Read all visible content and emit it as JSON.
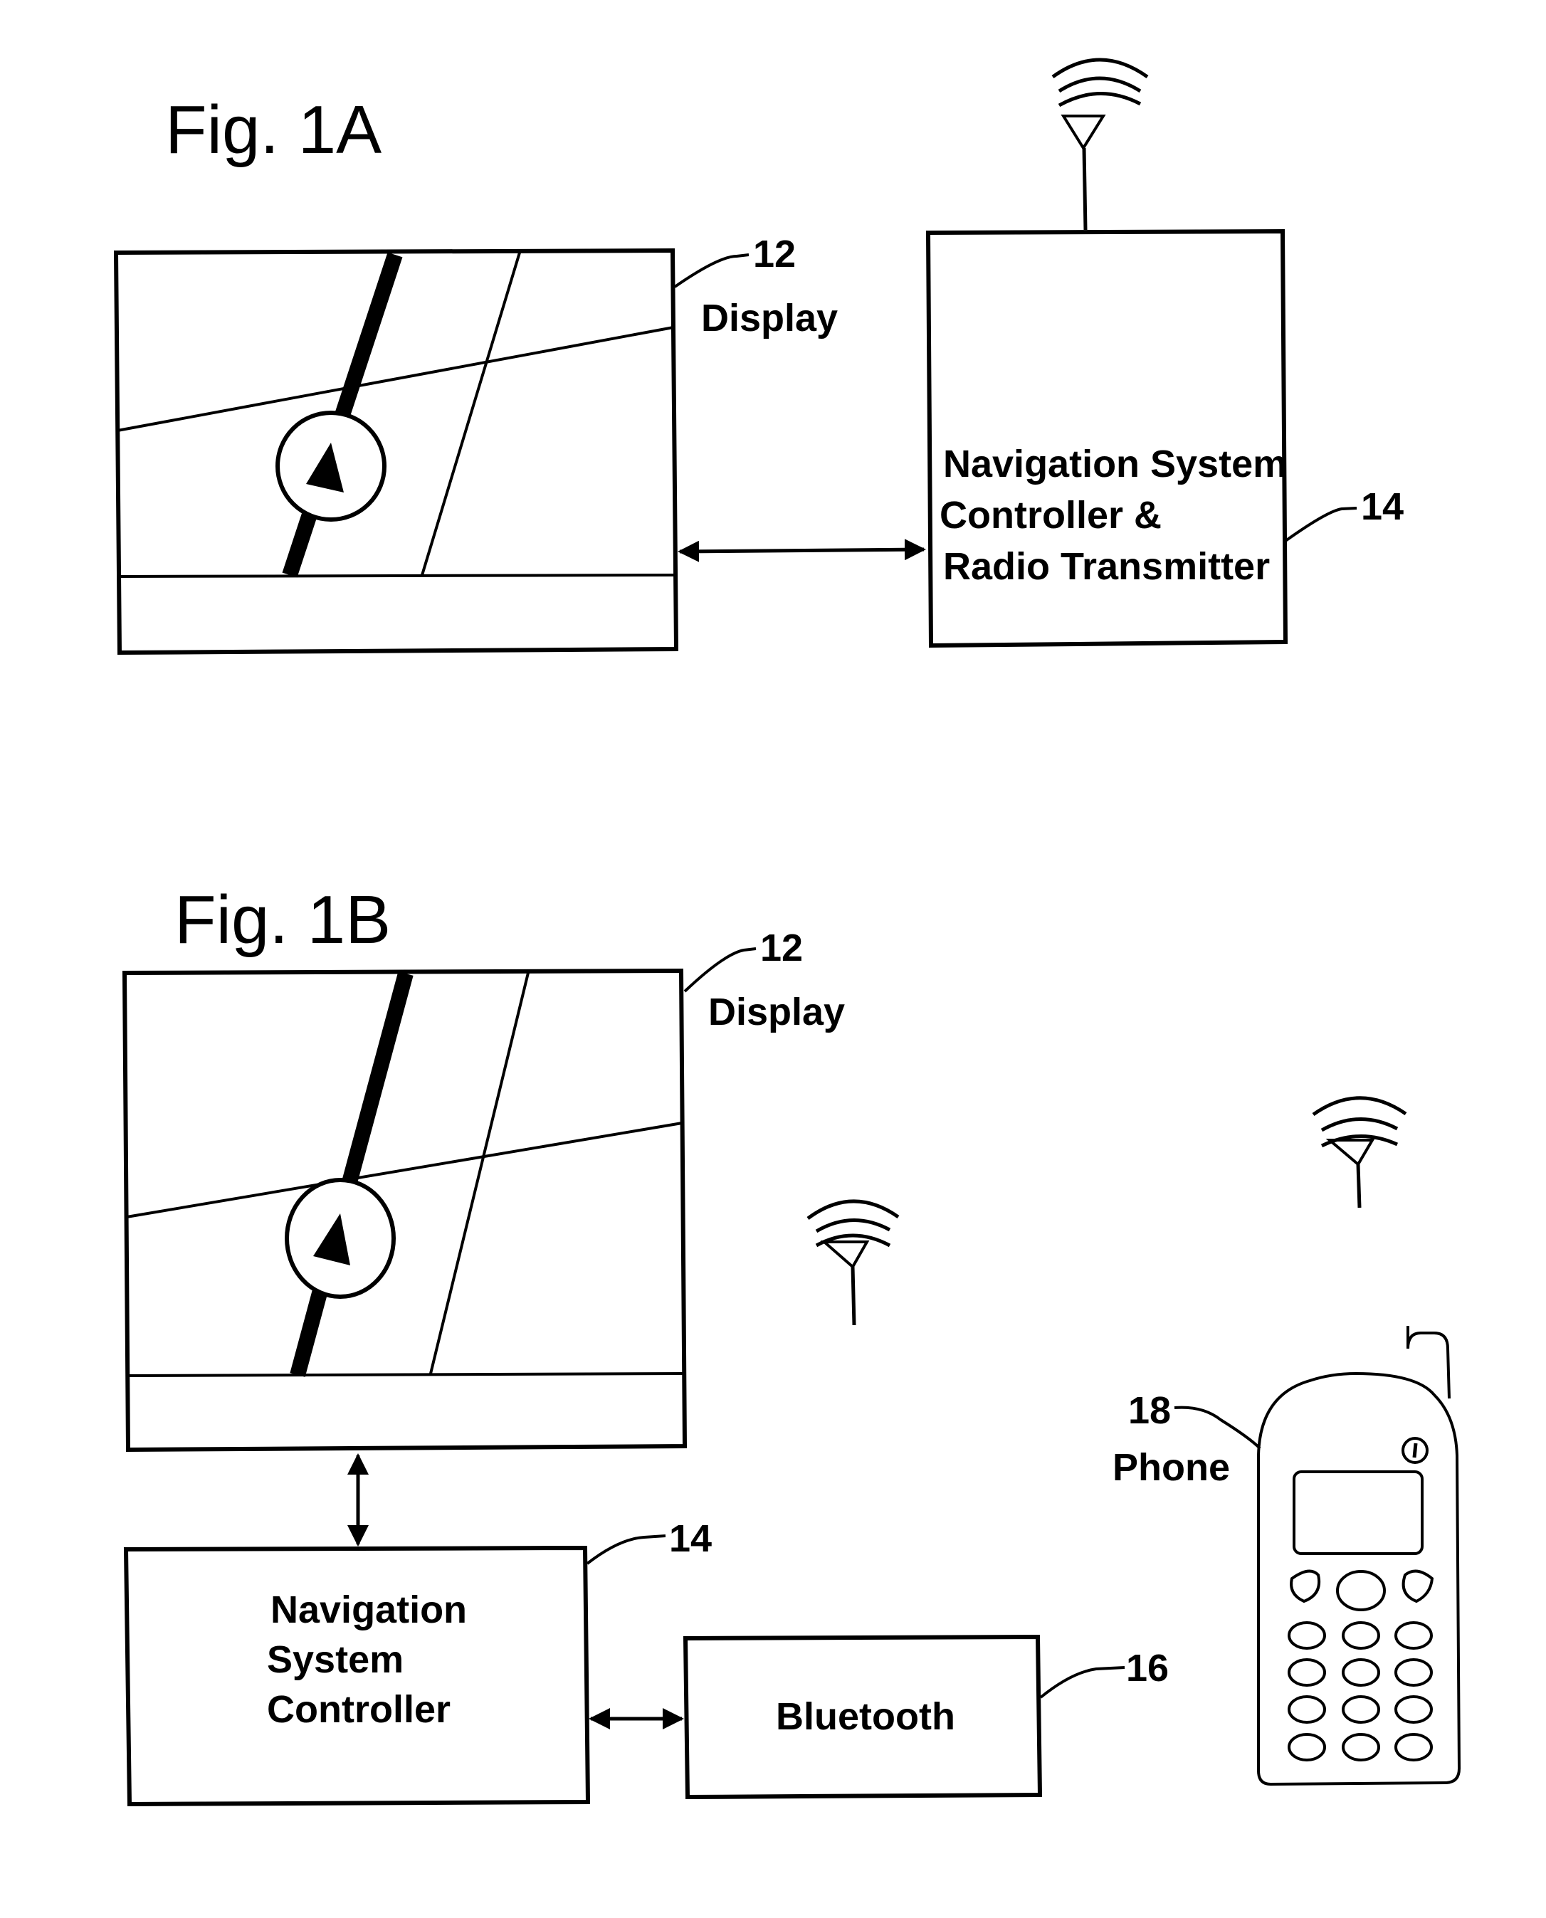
{
  "figures": [
    {
      "id": "1A",
      "title": "Fig. 1A",
      "display": {
        "ref": "12",
        "label": "Display"
      },
      "controller": {
        "ref": "14",
        "lines": [
          "Navigation System",
          "Controller &",
          "Radio Transmitter"
        ]
      },
      "connections": [
        {
          "from": "display",
          "to": "controller",
          "type": "bidirectional"
        }
      ],
      "antennas": [
        "controller"
      ]
    },
    {
      "id": "1B",
      "title": "Fig. 1B",
      "display": {
        "ref": "12",
        "label": "Display"
      },
      "controller": {
        "ref": "14",
        "lines": [
          "Navigation",
          "System",
          "Controller"
        ]
      },
      "bluetooth": {
        "ref": "16",
        "label": "Bluetooth"
      },
      "phone": {
        "ref": "18",
        "label": "Phone"
      },
      "connections": [
        {
          "from": "display",
          "to": "controller",
          "type": "bidirectional"
        },
        {
          "from": "controller",
          "to": "bluetooth",
          "type": "bidirectional"
        }
      ],
      "antennas": [
        "bluetooth",
        "phone"
      ]
    }
  ]
}
